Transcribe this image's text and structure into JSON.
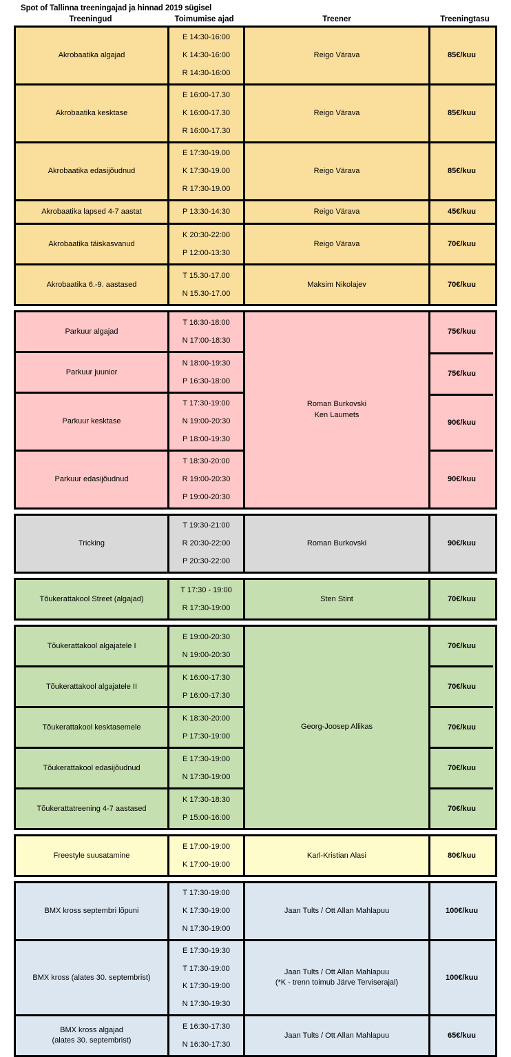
{
  "document": {
    "title": "Spot of Tallinna treeningajad ja hinnad 2019 sügisel"
  },
  "table": {
    "columns": [
      {
        "key": "training",
        "label": "Treeningud"
      },
      {
        "key": "times",
        "label": "Toimumise ajad"
      },
      {
        "key": "trainer",
        "label": "Treener"
      },
      {
        "key": "fee",
        "label": "Treeningtasu"
      }
    ],
    "colors": {
      "akrobaatika": "#FADE9C",
      "parkuur": "#FFC7C7",
      "tricking": "#D9D9D9",
      "toukerattakool": "#C6DFB0",
      "freestyle": "#FFFCCC",
      "bmx": "#DCE6F1",
      "border": "#000000"
    },
    "groups": [
      {
        "id": "akrobaatika",
        "shared_trainer": false,
        "rows": [
          {
            "training": "Akrobaatika algajad",
            "times": [
              "E 14:30-16:00",
              "K 14:30-16:00",
              "R 14:30-16:00"
            ],
            "trainer": [
              "Reigo Värava"
            ],
            "fee": "85€/kuu"
          },
          {
            "training": "Akrobaatika kesktase",
            "times": [
              "E 16:00-17.30",
              "K 16:00-17.30",
              "R 16:00-17.30"
            ],
            "trainer": [
              "Reigo Värava"
            ],
            "fee": "85€/kuu"
          },
          {
            "training": "Akrobaatika edasijõudnud",
            "times": [
              "E 17:30-19.00",
              "K 17:30-19.00",
              "R 17:30-19.00"
            ],
            "trainer": [
              "Reigo Värava"
            ],
            "fee": "85€/kuu"
          },
          {
            "training": "Akrobaatika lapsed 4-7 aastat",
            "times": [
              "P 13:30-14:30"
            ],
            "trainer": [
              "Reigo Värava"
            ],
            "fee": "45€/kuu"
          },
          {
            "training": "Akrobaatika täiskasvanud",
            "times": [
              "K 20:30-22:00",
              "P 12:00-13:30"
            ],
            "trainer": [
              "Reigo Värava"
            ],
            "fee": "70€/kuu"
          },
          {
            "training": "Akrobaatika 6.-9. aastased",
            "times": [
              "T 15.30-17.00",
              "N 15.30-17.00"
            ],
            "trainer": [
              "Maksim Nikolajev"
            ],
            "fee": "70€/kuu"
          }
        ]
      },
      {
        "id": "parkuur",
        "shared_trainer": true,
        "trainer": [
          "Roman Burkovski",
          "Ken Laumets"
        ],
        "rows": [
          {
            "training": "Parkuur algajad",
            "times": [
              "T 16:30-18:00",
              "N 17:00-18:30"
            ],
            "fee": "75€/kuu"
          },
          {
            "training": "Parkuur juunior",
            "times": [
              "N 18:00-19:30",
              "P 16:30-18:00"
            ],
            "fee": "75€/kuu"
          },
          {
            "training": "Parkuur kesktase",
            "times": [
              "T 17:30-19:00",
              "N 19:00-20:30",
              "P 18:00-19:30"
            ],
            "fee": "90€/kuu"
          },
          {
            "training": "Parkuur edasijõudnud",
            "times": [
              "T 18:30-20:00",
              "R 19:00-20:30",
              "P 19:00-20:30"
            ],
            "fee": "90€/kuu"
          }
        ]
      },
      {
        "id": "tricking",
        "shared_trainer": false,
        "rows": [
          {
            "training": "Tricking",
            "times": [
              "T 19:30-21:00",
              "R 20:30-22:00",
              "P 20:30-22:00"
            ],
            "trainer": [
              "Roman Burkovski"
            ],
            "fee": "90€/kuu"
          }
        ]
      },
      {
        "id": "toukerattakool-street",
        "shared_trainer": false,
        "rows": [
          {
            "training": "Tõukerattakool Street (algajad)",
            "times": [
              "T 17:30 - 19:00",
              "R 17:30-19:00"
            ],
            "trainer": [
              "Sten Stint"
            ],
            "fee": "70€/kuu"
          }
        ]
      },
      {
        "id": "toukerattakool",
        "shared_trainer": true,
        "trainer": [
          "Georg-Joosep Allikas"
        ],
        "rows": [
          {
            "training": "Tõukerattakool algajatele I",
            "times": [
              "E 19:00-20:30",
              "N 19:00-20:30"
            ],
            "fee": "70€/kuu"
          },
          {
            "training": "Tõukerattakool algajatele II",
            "times": [
              "K 16:00-17:30",
              "P 16:00-17:30"
            ],
            "fee": "70€/kuu"
          },
          {
            "training": "Tõukerattakool kesktasemele",
            "times": [
              "K 18:30-20:00",
              "P 17:30-19:00"
            ],
            "fee": "70€/kuu"
          },
          {
            "training": "Tõukerattakool edasijõudnud",
            "times": [
              "E 17:30-19:00",
              "N 17:30-19:00"
            ],
            "fee": "70€/kuu"
          },
          {
            "training": "Tõukerattatreening 4-7 aastased",
            "times": [
              "K 17:30-18:30",
              "P 15:00-16:00"
            ],
            "fee": "70€/kuu"
          }
        ]
      },
      {
        "id": "freestyle",
        "shared_trainer": false,
        "rows": [
          {
            "training": "Freestyle suusatamine",
            "times": [
              "E 17:00-19:00",
              "K 17:00-19:00"
            ],
            "trainer": [
              "Karl-Kristian Alasi"
            ],
            "fee": "80€/kuu"
          }
        ]
      },
      {
        "id": "bmx",
        "shared_trainer": false,
        "rows": [
          {
            "training": "BMX kross septembri lõpuni",
            "times": [
              "T 17:30-19:00",
              "K 17:30-19:00",
              "N 17:30-19:00"
            ],
            "trainer": [
              "Jaan Tults / Ott Allan Mahlapuu"
            ],
            "fee": "100€/kuu"
          },
          {
            "training": "BMX kross (alates 30. septembrist)",
            "times": [
              "E 17:30-19:30",
              "T 17:30-19:00",
              "K 17:30-19:00",
              "N 17:30-19:30"
            ],
            "trainer": [
              "Jaan Tults / Ott Allan Mahlapuu",
              "(*K - trenn toimub Järve Terviserajal)"
            ],
            "fee": "100€/kuu"
          },
          {
            "training": "BMX kross algajad\n(alates 30. septembrist)",
            "training_lines": [
              "BMX kross algajad",
              "(alates 30. septembrist)"
            ],
            "times": [
              "E 16:30-17:30",
              "N 16:30-17:30"
            ],
            "trainer": [
              "Jaan Tults / Ott Allan Mahlapuu"
            ],
            "fee": "65€/kuu"
          }
        ]
      }
    ]
  }
}
